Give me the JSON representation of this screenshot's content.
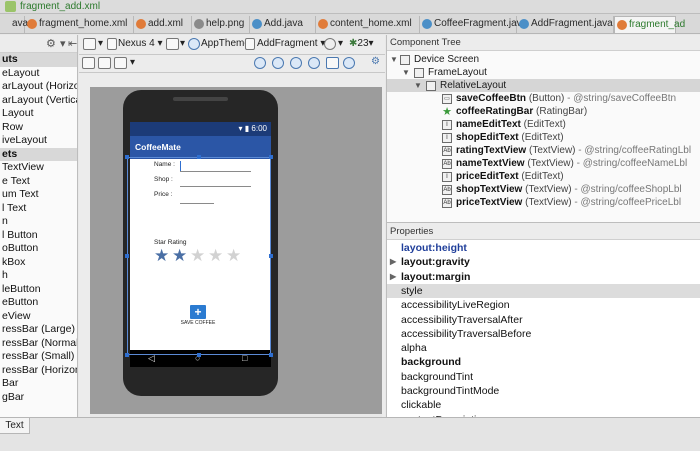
{
  "window": {
    "title": "fragment_add.xml"
  },
  "tabs": [
    {
      "label": "ava",
      "icon": "none"
    },
    {
      "label": "fragment_home.xml",
      "icon": "xml-icon"
    },
    {
      "label": "add.xml",
      "icon": "xml-icon"
    },
    {
      "label": "help.png",
      "icon": "image-icon"
    },
    {
      "label": "Add.java",
      "icon": "class-icon"
    },
    {
      "label": "content_home.xml",
      "icon": "xml-icon"
    },
    {
      "label": "CoffeeFragment.java",
      "icon": "class-icon"
    },
    {
      "label": "AddFragment.java",
      "icon": "class-icon"
    },
    {
      "label": "fragment_ad",
      "icon": "xml-icon"
    }
  ],
  "palette": {
    "items": [
      {
        "label": "uts",
        "group": true
      },
      {
        "label": "eLayout",
        "group": false
      },
      {
        "label": "arLayout (Horizontal)",
        "group": false
      },
      {
        "label": "arLayout (Vertical)",
        "group": false
      },
      {
        "label": "Layout",
        "group": false
      },
      {
        "label": "Row",
        "group": false
      },
      {
        "label": "iveLayout",
        "group": false
      },
      {
        "label": "ets",
        "group": true
      },
      {
        "label": "TextView",
        "group": false
      },
      {
        "label": "e Text",
        "group": false
      },
      {
        "label": "um Text",
        "group": false
      },
      {
        "label": "l Text",
        "group": false
      },
      {
        "label": "n",
        "group": false
      },
      {
        "label": "l Button",
        "group": false
      },
      {
        "label": "oButton",
        "group": false
      },
      {
        "label": "kBox",
        "group": false
      },
      {
        "label": "h",
        "group": false
      },
      {
        "label": "leButton",
        "group": false
      },
      {
        "label": "eButton",
        "group": false
      },
      {
        "label": "eView",
        "group": false
      },
      {
        "label": "ressBar (Large)",
        "group": false
      },
      {
        "label": "ressBar (Normal)",
        "group": false
      },
      {
        "label": "ressBar (Small)",
        "group": false
      },
      {
        "label": "ressBar (Horizontal)",
        "group": false
      },
      {
        "label": "Bar",
        "group": false
      },
      {
        "label": "gBar",
        "group": false
      }
    ]
  },
  "design_toolbar": {
    "device": "Nexus 4",
    "theme": "AppTheme",
    "activity": "AddFragment",
    "api": "23"
  },
  "device_preview": {
    "app_name": "CoffeeMate",
    "clock": "6:00",
    "name_label": "Name :",
    "shop_label": "Shop :",
    "price_label": "Price :",
    "rating_label": "Star Rating",
    "rating": 2,
    "rating_max": 5,
    "save_caption": "SAVE COFFEE"
  },
  "component_tree": {
    "header": "Component Tree",
    "device_screen": "Device Screen",
    "frame_layout": "FrameLayout",
    "relative_layout": "RelativeLayout",
    "children": [
      {
        "name": "saveCoffeeBtn",
        "type": "(Button)",
        "ref": "- @string/saveCoffeeBtn",
        "icon": "button-icon"
      },
      {
        "name": "coffeeRatingBar",
        "type": "(RatingBar)",
        "ref": "",
        "icon": "star-icon"
      },
      {
        "name": "nameEditText",
        "type": "(EditText)",
        "ref": "",
        "icon": "edittext-icon"
      },
      {
        "name": "shopEditText",
        "type": "(EditText)",
        "ref": "",
        "icon": "edittext-icon"
      },
      {
        "name": "ratingTextView",
        "type": "(TextView)",
        "ref": "- @string/coffeeRatingLbl",
        "icon": "textview-icon"
      },
      {
        "name": "nameTextView",
        "type": "(TextView)",
        "ref": "- @string/coffeeNameLbl",
        "icon": "textview-icon"
      },
      {
        "name": "priceEditText",
        "type": "(EditText)",
        "ref": "",
        "icon": "edittext-icon"
      },
      {
        "name": "shopTextView",
        "type": "(TextView)",
        "ref": "- @string/coffeeShopLbl",
        "icon": "textview-icon"
      },
      {
        "name": "priceTextView",
        "type": "(TextView)",
        "ref": "- @string/coffeePriceLbl",
        "icon": "textview-icon"
      }
    ]
  },
  "properties": {
    "header": "Properties",
    "rows": [
      {
        "label": "layout:height",
        "style": "blue",
        "expandable": false
      },
      {
        "label": "layout:gravity",
        "style": "bold",
        "expandable": true
      },
      {
        "label": "layout:margin",
        "style": "bold",
        "expandable": true
      },
      {
        "label": "style",
        "style": "shade",
        "expandable": false
      },
      {
        "label": "accessibilityLiveRegion",
        "style": "plain",
        "expandable": false
      },
      {
        "label": "accessibilityTraversalAfter",
        "style": "plain",
        "expandable": false
      },
      {
        "label": "accessibilityTraversalBefore",
        "style": "plain",
        "expandable": false
      },
      {
        "label": "alpha",
        "style": "plain",
        "expandable": false
      },
      {
        "label": "background",
        "style": "bold",
        "expandable": false
      },
      {
        "label": "backgroundTint",
        "style": "plain",
        "expandable": false
      },
      {
        "label": "backgroundTintMode",
        "style": "plain",
        "expandable": false
      },
      {
        "label": "clickable",
        "style": "plain",
        "expandable": false
      },
      {
        "label": "contentDescription",
        "style": "plain",
        "expandable": false
      }
    ]
  },
  "bottom": {
    "text_tab": "Text"
  },
  "colors": {
    "accent": "#2b56a6",
    "status": "#1c3b78",
    "star_on": "#4a6fa5",
    "file_green": "#2d7a2d"
  }
}
